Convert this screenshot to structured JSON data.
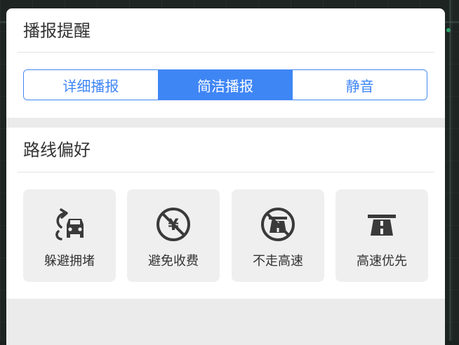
{
  "broadcast": {
    "title": "播报提醒",
    "options": [
      {
        "label": "详细播报",
        "selected": false
      },
      {
        "label": "简洁播报",
        "selected": true
      },
      {
        "label": "静音",
        "selected": false
      }
    ]
  },
  "route_pref": {
    "title": "路线偏好",
    "items": [
      {
        "label": "躲避拥堵",
        "icon": "avoid-congestion-icon"
      },
      {
        "label": "避免收费",
        "icon": "no-toll-icon"
      },
      {
        "label": "不走高速",
        "icon": "no-highway-icon"
      },
      {
        "label": "高速优先",
        "icon": "highway-first-icon"
      }
    ]
  },
  "colors": {
    "accent": "#3f86f5",
    "card_bg": "#efefef",
    "text": "#333333",
    "icon": "#3a3a3a"
  }
}
